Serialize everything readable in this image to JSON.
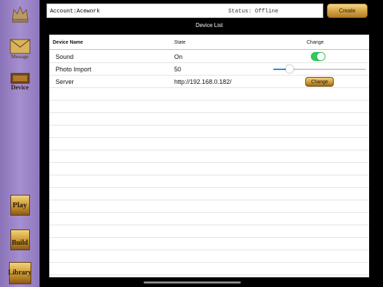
{
  "sidebar": {
    "items": [
      {
        "label": "",
        "icon": "crown-icon"
      },
      {
        "label": "Message",
        "icon": "envelope-icon"
      },
      {
        "label": "Device",
        "icon": "device-icon"
      },
      {
        "label": "Play",
        "icon": "play-icon"
      },
      {
        "label": "Build",
        "icon": "build-icon"
      },
      {
        "label": "Library",
        "icon": "library-icon"
      }
    ]
  },
  "header": {
    "account": "Account:Acework",
    "status": "Status: Offline",
    "create_label": "Create",
    "section_title": "Device List"
  },
  "table": {
    "columns": [
      "Device Name",
      "State",
      "Change"
    ],
    "rows": [
      {
        "name": "Sound",
        "state": "On",
        "control": "toggle",
        "value": true
      },
      {
        "name": "Photo Import",
        "state": "50",
        "control": "slider",
        "value": 0.17
      },
      {
        "name": "Server",
        "state": "http://192.168.0.182/",
        "control": "button",
        "button_label": "Change"
      }
    ]
  },
  "colors": {
    "toggle_on": "#34c759",
    "gold": "#d6a548",
    "sidebar": "#a58fcf"
  }
}
